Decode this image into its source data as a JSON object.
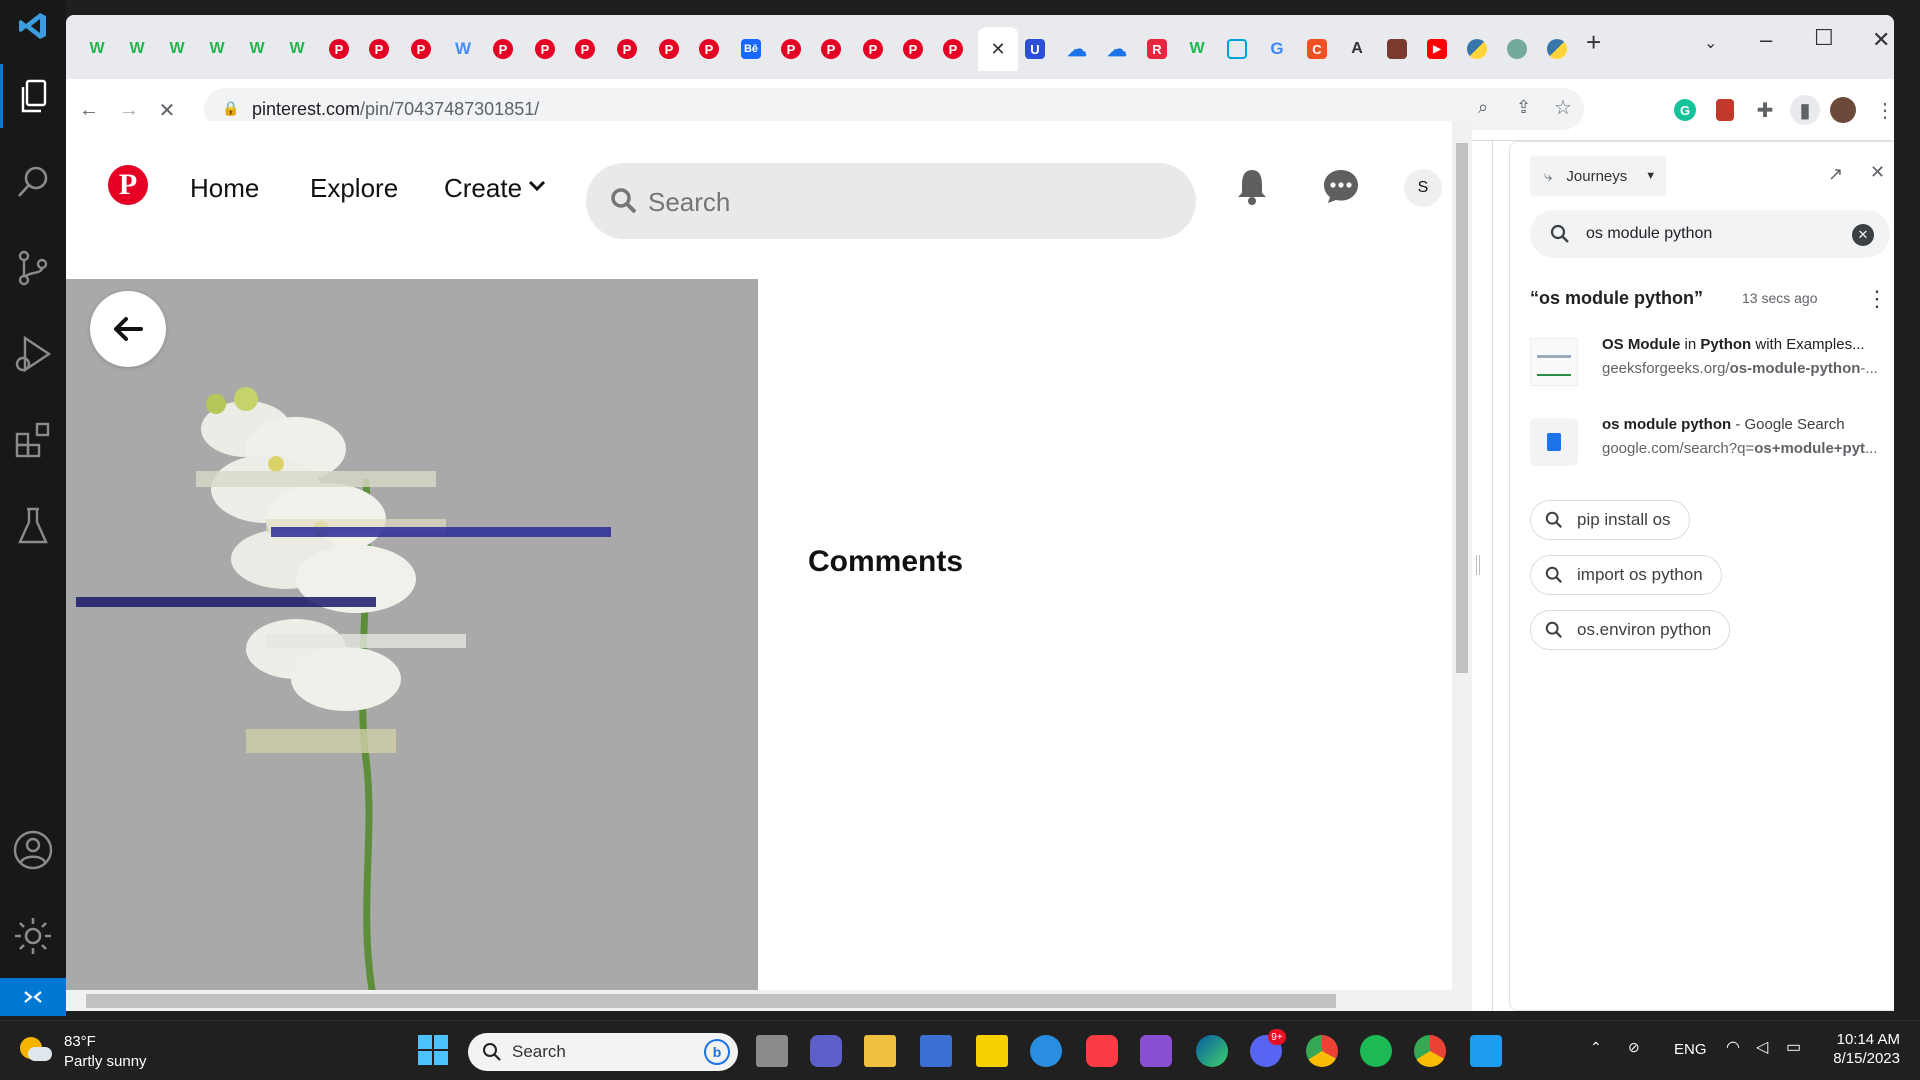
{
  "browser": {
    "url_host": "pinterest.com",
    "url_path": "/pin/70437487301851/",
    "active_tab_close": "✕",
    "new_tab": "+"
  },
  "pinterest": {
    "nav": {
      "home": "Home",
      "explore": "Explore",
      "create": "Create"
    },
    "search_placeholder": "Search",
    "avatar_letter": "S",
    "comments_heading": "Comments"
  },
  "side_panel": {
    "selector_label": "Journeys",
    "search_query": "os module python",
    "journey_title": "“os module python”",
    "journey_time": "13 secs ago",
    "results": [
      {
        "title_bold": "OS Module",
        "title_mid": " in ",
        "title_bold2": "Python",
        "title_rest": " with Examples...",
        "url_plain": "geeksforgeeks.org/",
        "url_bold": "os-module-python",
        "url_rest": "-..."
      },
      {
        "title_bold": "os module python",
        "title_rest": " - Google Search",
        "url_plain": "google.com/search?q=",
        "url_bold": "os+module+pyt",
        "url_rest": "..."
      }
    ],
    "suggestions": [
      "pip install os",
      "import os python",
      "os.environ python"
    ]
  },
  "taskbar": {
    "temperature": "83°F",
    "condition": "Partly sunny",
    "search_label": "Search",
    "discord_badge": "9+",
    "lang": "ENG",
    "time": "10:14 AM",
    "date": "8/15/2023"
  }
}
